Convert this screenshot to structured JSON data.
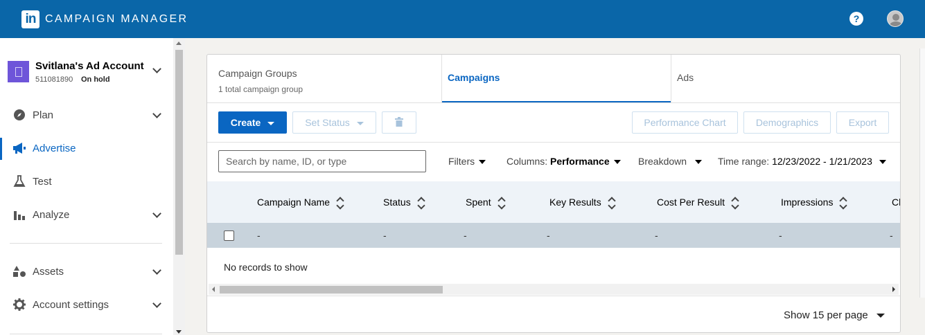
{
  "topbar": {
    "brand": "CAMPAIGN MANAGER",
    "logo_text": "in",
    "help_label": "?"
  },
  "account": {
    "name": "Svitlana's Ad Account",
    "id": "511081890",
    "status": "On hold"
  },
  "nav": {
    "plan": "Plan",
    "advertise": "Advertise",
    "test": "Test",
    "analyze": "Analyze",
    "assets": "Assets",
    "account_settings": "Account settings"
  },
  "tabs": {
    "groups_title": "Campaign Groups",
    "groups_sub": "1 total campaign group",
    "campaigns": "Campaigns",
    "ads": "Ads"
  },
  "toolbar": {
    "create": "Create",
    "set_status": "Set Status",
    "performance_chart": "Performance Chart",
    "demographics": "Demographics",
    "export": "Export"
  },
  "filters": {
    "search_placeholder": "Search by name, ID, or type",
    "filters": "Filters",
    "columns_label": "Columns:",
    "columns_value": "Performance",
    "breakdown": "Breakdown",
    "time_range_label": "Time range:",
    "time_range_value": "12/23/2022 - 1/21/2023"
  },
  "table": {
    "headers": [
      "Campaign Name",
      "Status",
      "Spent",
      "Key Results",
      "Cost Per Result",
      "Impressions",
      "Cl"
    ],
    "row": [
      "-",
      "-",
      "-",
      "-",
      "-",
      "-",
      "-"
    ],
    "empty": "No records to show"
  },
  "pagination": {
    "label": "Show 15 per page"
  },
  "colors": {
    "topbar": "#0a66a8",
    "accent": "#0a66c2",
    "account_icon": "#6e55d9"
  }
}
